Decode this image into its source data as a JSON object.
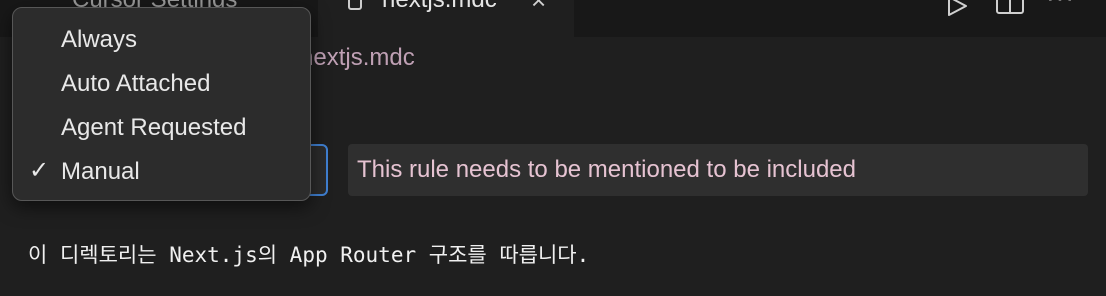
{
  "tabs": {
    "inactive_label": "Cursor Settings",
    "active_label": "nextjs.mdc"
  },
  "toolbar": {
    "run_icon": "play-icon",
    "split_icon": "split-editor-icon",
    "more_icon": "more-icon",
    "more_label": "···"
  },
  "breadcrumb": {
    "label": "nextjs.mdc"
  },
  "rule": {
    "type_options": [
      "Always",
      "Auto Attached",
      "Agent Requested",
      "Manual"
    ],
    "selected": "Manual",
    "check_mark": "✓",
    "description": "This rule needs to be mentioned to be included"
  },
  "content": {
    "line_1": "이 디렉토리는 Next.js의 App Router 구조를 따릅니다."
  }
}
